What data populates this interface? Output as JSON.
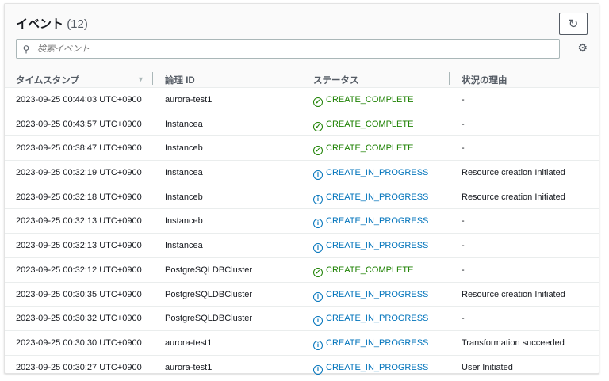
{
  "title": "イベント",
  "count": "(12)",
  "search_placeholder": "検索イベント",
  "columns": [
    "タイムスタンプ",
    "論理 ID",
    "ステータス",
    "状況の理由"
  ],
  "colors": {
    "complete": "#1d8102",
    "in_progress": "#0073bb"
  },
  "rows": [
    {
      "ts": "2023-09-25 00:44:03 UTC+0900",
      "id": "aurora-test1",
      "status": "CREATE_COMPLETE",
      "type": "ok",
      "reason": "-"
    },
    {
      "ts": "2023-09-25 00:43:57 UTC+0900",
      "id": "Instancea",
      "status": "CREATE_COMPLETE",
      "type": "ok",
      "reason": "-"
    },
    {
      "ts": "2023-09-25 00:38:47 UTC+0900",
      "id": "Instanceb",
      "status": "CREATE_COMPLETE",
      "type": "ok",
      "reason": "-"
    },
    {
      "ts": "2023-09-25 00:32:19 UTC+0900",
      "id": "Instancea",
      "status": "CREATE_IN_PROGRESS",
      "type": "prog",
      "reason": "Resource creation Initiated"
    },
    {
      "ts": "2023-09-25 00:32:18 UTC+0900",
      "id": "Instanceb",
      "status": "CREATE_IN_PROGRESS",
      "type": "prog",
      "reason": "Resource creation Initiated"
    },
    {
      "ts": "2023-09-25 00:32:13 UTC+0900",
      "id": "Instanceb",
      "status": "CREATE_IN_PROGRESS",
      "type": "prog",
      "reason": "-"
    },
    {
      "ts": "2023-09-25 00:32:13 UTC+0900",
      "id": "Instancea",
      "status": "CREATE_IN_PROGRESS",
      "type": "prog",
      "reason": "-"
    },
    {
      "ts": "2023-09-25 00:32:12 UTC+0900",
      "id": "PostgreSQLDBCluster",
      "status": "CREATE_COMPLETE",
      "type": "ok",
      "reason": "-"
    },
    {
      "ts": "2023-09-25 00:30:35 UTC+0900",
      "id": "PostgreSQLDBCluster",
      "status": "CREATE_IN_PROGRESS",
      "type": "prog",
      "reason": "Resource creation Initiated"
    },
    {
      "ts": "2023-09-25 00:30:32 UTC+0900",
      "id": "PostgreSQLDBCluster",
      "status": "CREATE_IN_PROGRESS",
      "type": "prog",
      "reason": "-"
    },
    {
      "ts": "2023-09-25 00:30:30 UTC+0900",
      "id": "aurora-test1",
      "status": "CREATE_IN_PROGRESS",
      "type": "prog",
      "reason": "Transformation succeeded"
    },
    {
      "ts": "2023-09-25 00:30:27 UTC+0900",
      "id": "aurora-test1",
      "status": "CREATE_IN_PROGRESS",
      "type": "prog",
      "reason": "User Initiated"
    }
  ]
}
